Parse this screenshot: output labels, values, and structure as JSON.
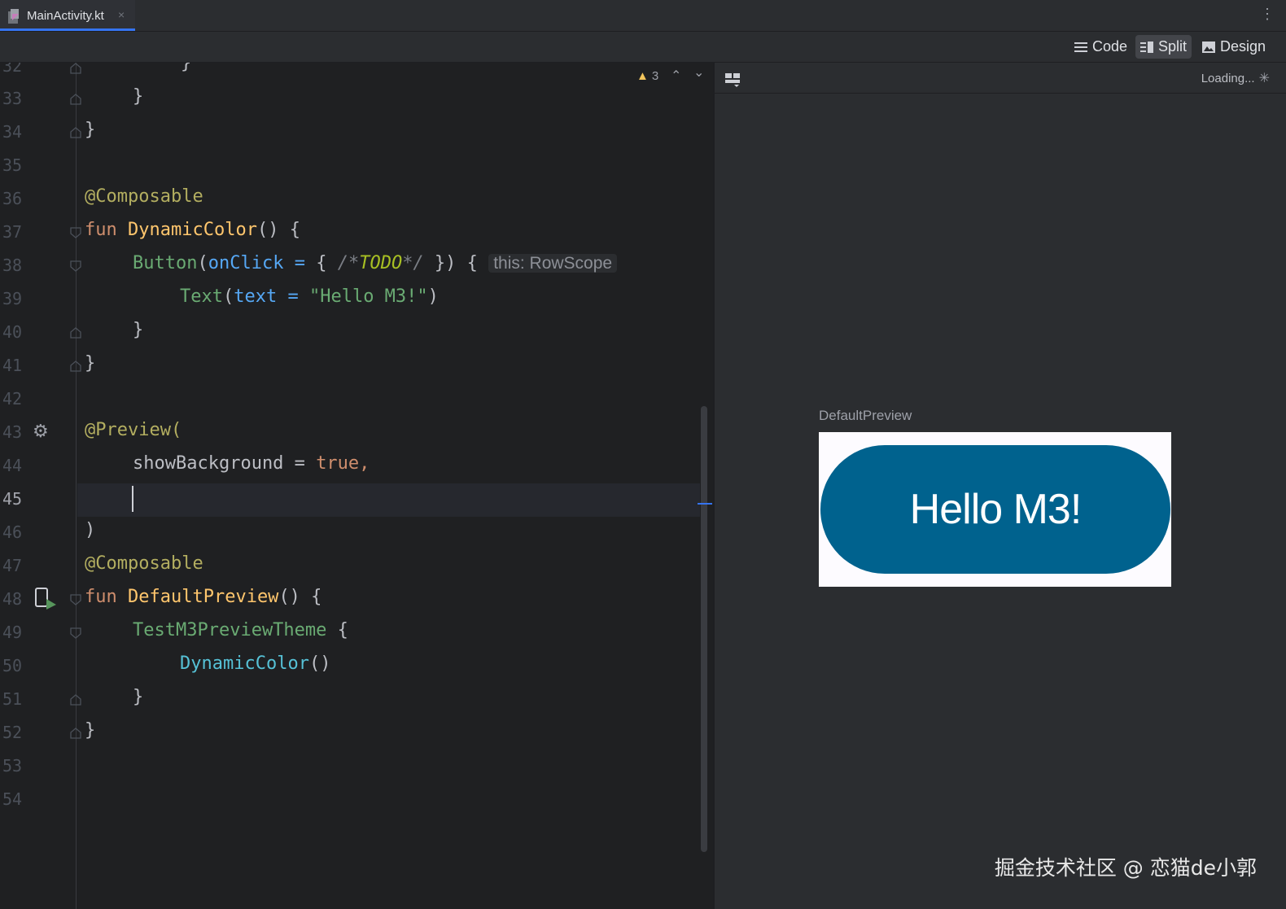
{
  "tab": {
    "label": "MainActivity.kt",
    "close": "×"
  },
  "toolbar": {
    "kebab": "⋮",
    "code_label": "Code",
    "split_label": "Split",
    "design_label": "Design",
    "active_mode": "Split"
  },
  "editor": {
    "warnings_count": "3",
    "current_line": "45",
    "lines": [
      {
        "n": "32",
        "text": "}"
      },
      {
        "n": "33",
        "text": "}"
      },
      {
        "n": "34",
        "text": "}"
      },
      {
        "n": "35",
        "text": ""
      },
      {
        "n": "36",
        "text": "@Composable"
      },
      {
        "n": "37",
        "text": "fun DynamicColor() {"
      },
      {
        "n": "38",
        "text": "Button(onClick = { /*TODO*/ }) {"
      },
      {
        "n": "39",
        "text": "Text(text = \"Hello M3!\")"
      },
      {
        "n": "40",
        "text": "}"
      },
      {
        "n": "41",
        "text": "}"
      },
      {
        "n": "42",
        "text": ""
      },
      {
        "n": "43",
        "text": "@Preview("
      },
      {
        "n": "44",
        "text": "showBackground = true,"
      },
      {
        "n": "45",
        "text": ""
      },
      {
        "n": "46",
        "text": ")"
      },
      {
        "n": "47",
        "text": "@Composable"
      },
      {
        "n": "48",
        "text": "fun DefaultPreview() {"
      },
      {
        "n": "49",
        "text": "TestM3PreviewTheme {"
      },
      {
        "n": "50",
        "text": "DynamicColor()"
      },
      {
        "n": "51",
        "text": "}"
      },
      {
        "n": "52",
        "text": "}"
      },
      {
        "n": "53",
        "text": ""
      },
      {
        "n": "54",
        "text": ""
      }
    ],
    "tokens": {
      "composable": "@Composable",
      "fun": "fun",
      "dynamic_color": "DynamicColor",
      "parens_brace": "() {",
      "button": "Button",
      "open_paren": "(",
      "on_click": "onClick",
      "eq": " = ",
      "brace_open": "{ ",
      "comment_open": "/*",
      "todo": "TODO",
      "comment_close": "*/",
      "brace_close_paren": " })",
      "trailing_brace": " { ",
      "inlay_hint": "this: RowScope",
      "text_fn": "Text",
      "text_param": "text",
      "hello_string": "\"Hello M3!\"",
      "close_paren": ")",
      "close_brace": "}",
      "preview_anno": "@Preview(",
      "show_background": "showBackground",
      "eq_plain": " = ",
      "true_kw": "true,",
      "default_preview": "DefaultPreview",
      "theme": "TestM3PreviewTheme",
      "theme_brace": " {",
      "dynamic_color_call": "DynamicColor",
      "empty_parens": "()"
    }
  },
  "preview": {
    "loading_label": "Loading...",
    "preview_name": "DefaultPreview",
    "button_text": "Hello M3!",
    "button_color": "#00628e",
    "background_color": "#fdfbff"
  },
  "watermark": "掘金技术社区 @ 恋猫de小郭",
  "colors": {
    "accent": "#3574f0",
    "editor_bg": "#1f2022",
    "panel_bg": "#2b2d30"
  }
}
